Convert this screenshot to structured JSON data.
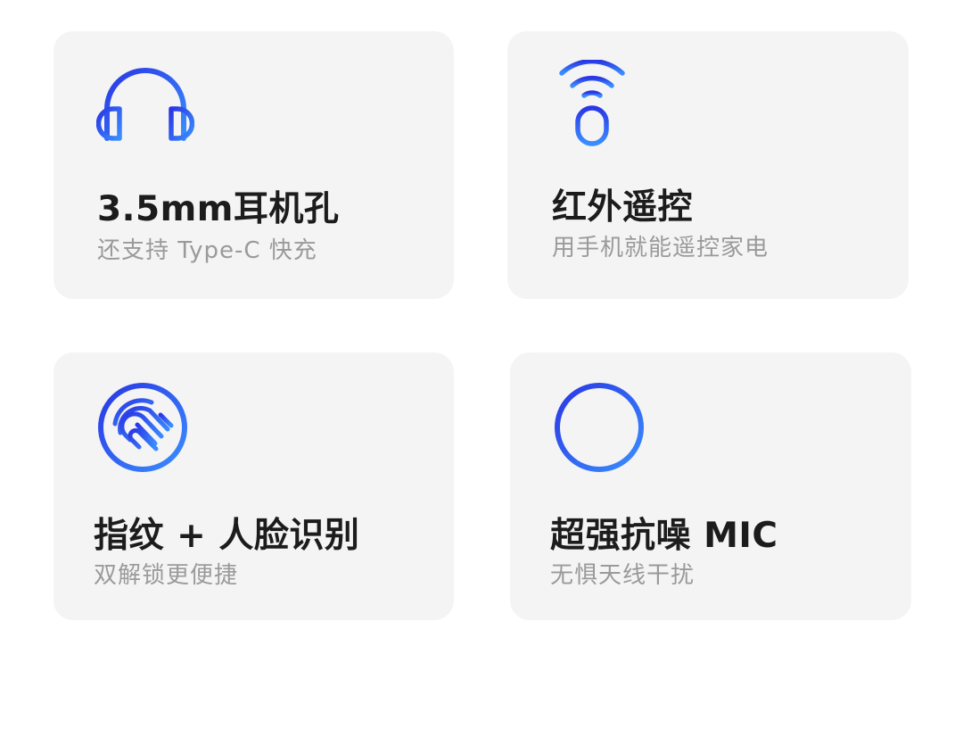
{
  "colors": {
    "card_background": "#f4f4f4",
    "title": "#1c1c1c",
    "subtitle": "#9a9a9a",
    "icon_gradient_start": "#2a37e4",
    "icon_gradient_end": "#3a8eff"
  },
  "features": [
    {
      "icon": "headphones-icon",
      "title": "3.5mm耳机孔",
      "subtitle": "还支持 Type-C 快充"
    },
    {
      "icon": "infrared-remote-icon",
      "title": "红外遥控",
      "subtitle": "用手机就能遥控家电"
    },
    {
      "icon": "fingerprint-icon",
      "title": "指纹 + 人脸识别",
      "subtitle": "双解锁更便捷"
    },
    {
      "icon": "microphone-waveform-icon",
      "title": "超强抗噪 MIC",
      "subtitle": "无惧天线干扰"
    }
  ]
}
